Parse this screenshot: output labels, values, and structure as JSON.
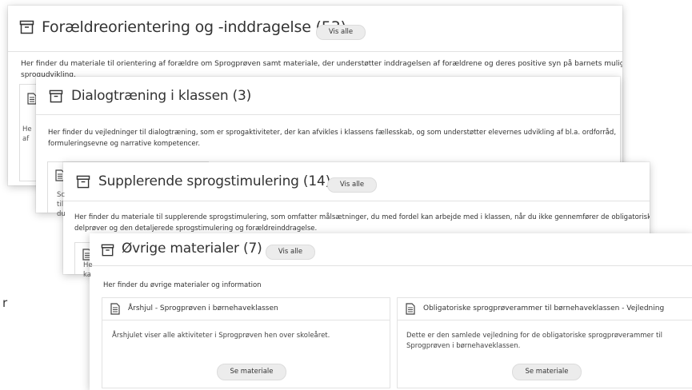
{
  "stray_letter": "r",
  "cards": [
    {
      "title": "Forældreorientering og -inddragelse (53)",
      "vis_alle": "Vis alle",
      "desc_line1": "Her finder du materiale til orientering af forældre om Sprogprøven samt materiale, der understøtter inddragelsen af forældrene og deres positive syn på barnets muligheder for",
      "desc_line2": "sprogudvikling."
    },
    {
      "title": "Dialogtræning i klassen (3)",
      "desc_line1": "Her finder du vejledninger til dialogtræning, som er sprogaktiviteter, der kan afvikles i klassens fællesskab, og som understøtter elevernes udvikling af bl.a. ordforråd,",
      "desc_line2": "formuleringsevne og narrative kompetencer.",
      "peek_lines": [
        "He",
        "af"
      ]
    },
    {
      "title": "Supplerende sprogstimulering (14)",
      "vis_alle": "Vis alle",
      "desc_line1": "Her finder du materiale til supplerende sprogstimulering, som omfatter målsætninger, du med fordel kan arbejde med i klassen, når du ikke gennemfører de obligatoriske",
      "desc_line2": "delprøver og den detaljerede sprogstimulering og forældreinddragelse.",
      "peek_lines": [
        "Sc",
        "til",
        "du"
      ]
    },
    {
      "title": "Øvrige materialer (7)",
      "vis_alle": "Vis alle",
      "desc": "Her finder du øvrige materialer og information",
      "peek_lines": [
        "He",
        "ka"
      ],
      "tiles": [
        {
          "title": "Årshjul - Sprogprøven i børnehaveklassen",
          "text_line1": "Årshjulet viser alle aktiviteter i Sprogprøven hen over skoleåret.",
          "text_line2": "",
          "button": "Se materiale"
        },
        {
          "title": "Obligatoriske sprogprøverammer til børnehaveklassen - Vejledning",
          "text_line1": "Dette er den samlede vejledning for de obligatoriske sprogprøverammer til",
          "text_line2": "Sprogprøven i børnehaveklassen.",
          "button": "Se materiale"
        }
      ]
    }
  ]
}
